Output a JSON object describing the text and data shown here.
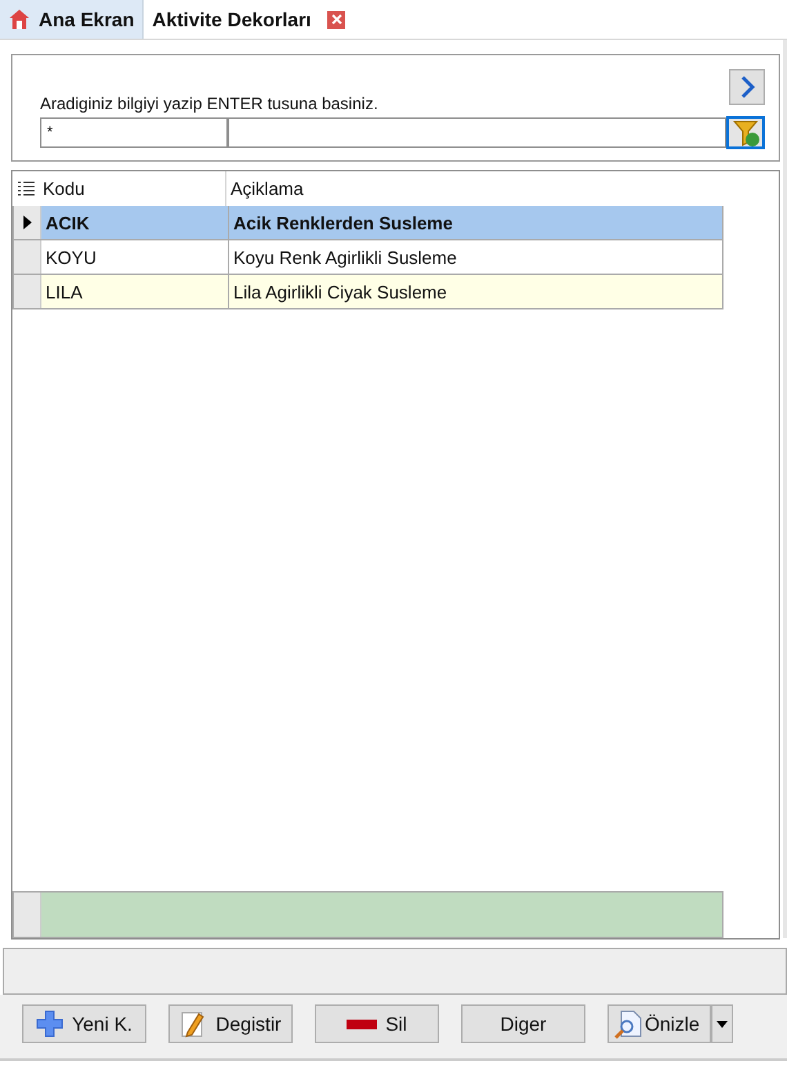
{
  "tabs": [
    {
      "label": "Ana Ekran",
      "selected": false,
      "closable": false
    },
    {
      "label": "Aktivite Dekorları",
      "selected": true,
      "closable": true
    }
  ],
  "search": {
    "hint": "Aradiginiz bilgiyi yazip ENTER tusuna basiniz.",
    "value": "*"
  },
  "table": {
    "columns": [
      "Kodu",
      "Açiklama"
    ],
    "rows": [
      {
        "cells": [
          "ACIK",
          "Acik Renklerden Susleme"
        ],
        "selected": true
      },
      {
        "cells": [
          "KOYU",
          "Koyu Renk Agirlikli Susleme"
        ],
        "selected": false
      },
      {
        "cells": [
          "LILA",
          "Lila Agirlikli Ciyak Susleme"
        ],
        "selected": false
      }
    ]
  },
  "buttons": [
    {
      "label": "Yeni K.",
      "kind": "add",
      "dropdown": false
    },
    {
      "label": "Degistir",
      "kind": "edit",
      "dropdown": false
    },
    {
      "label": "Sil",
      "kind": "delete",
      "dropdown": false
    },
    {
      "label": "Diger",
      "kind": "plain",
      "dropdown": false
    },
    {
      "label": "Önizle",
      "kind": "preview",
      "dropdown": true
    }
  ]
}
